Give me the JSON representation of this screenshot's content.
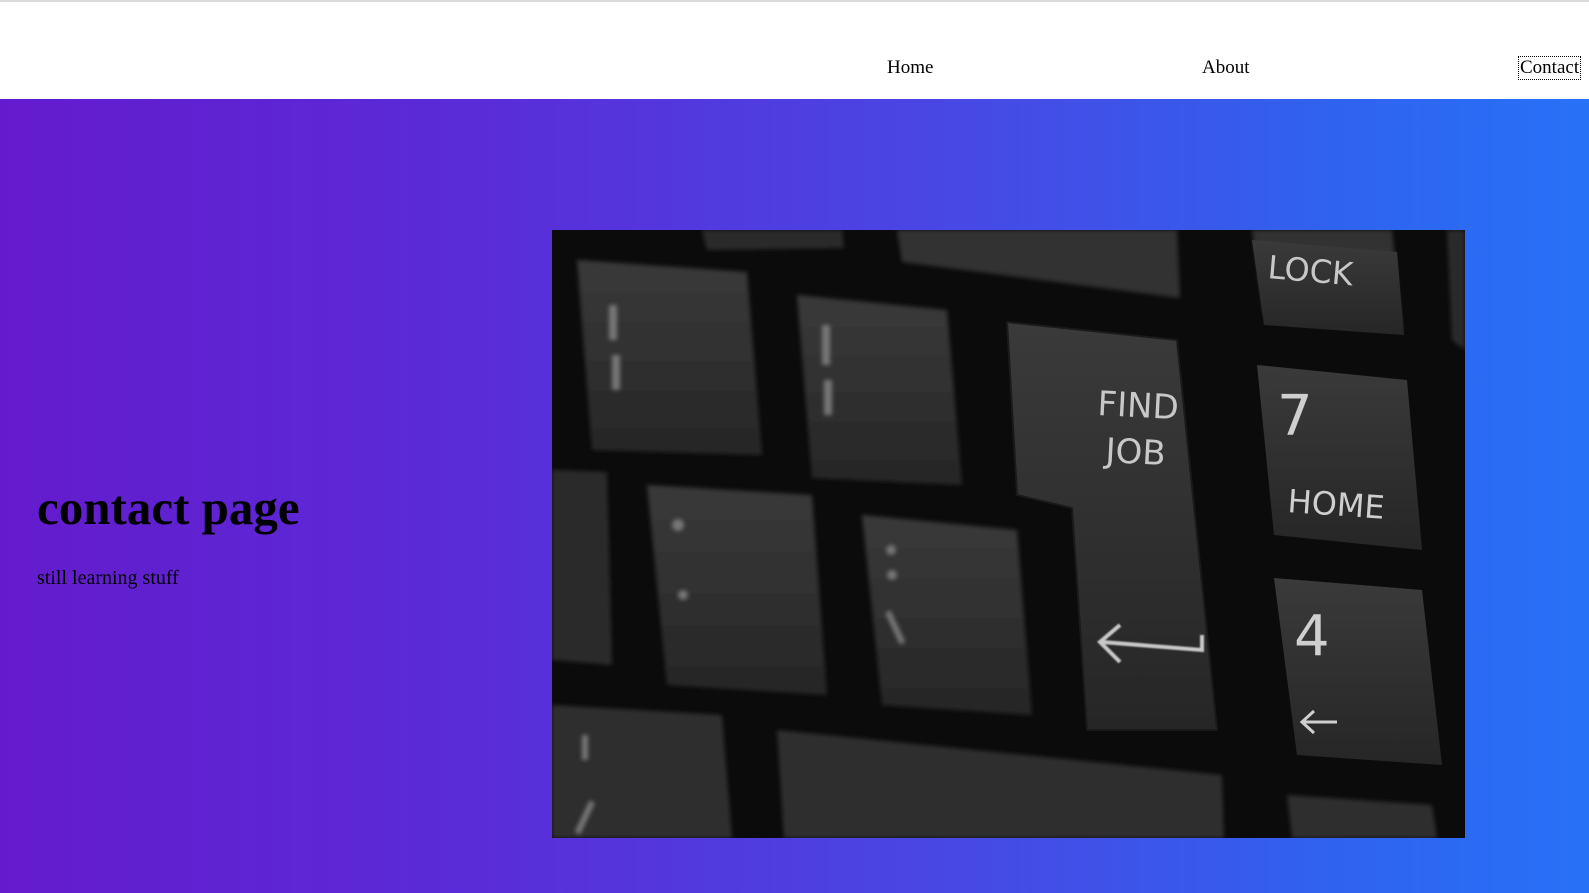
{
  "nav": {
    "home_label": "Home",
    "about_label": "About",
    "contact_label": "Contact"
  },
  "hero": {
    "title": "contact page",
    "subtitle": "still learning stuff",
    "gradient_start": "#641bcd",
    "gradient_end": "#2771f7",
    "image": {
      "description_icon": "keyboard-photo",
      "key_labels": {
        "lock": "LOCK",
        "find": "FIND",
        "job": "JOB",
        "seven": "7",
        "home": "HOME",
        "four": "4"
      }
    }
  }
}
